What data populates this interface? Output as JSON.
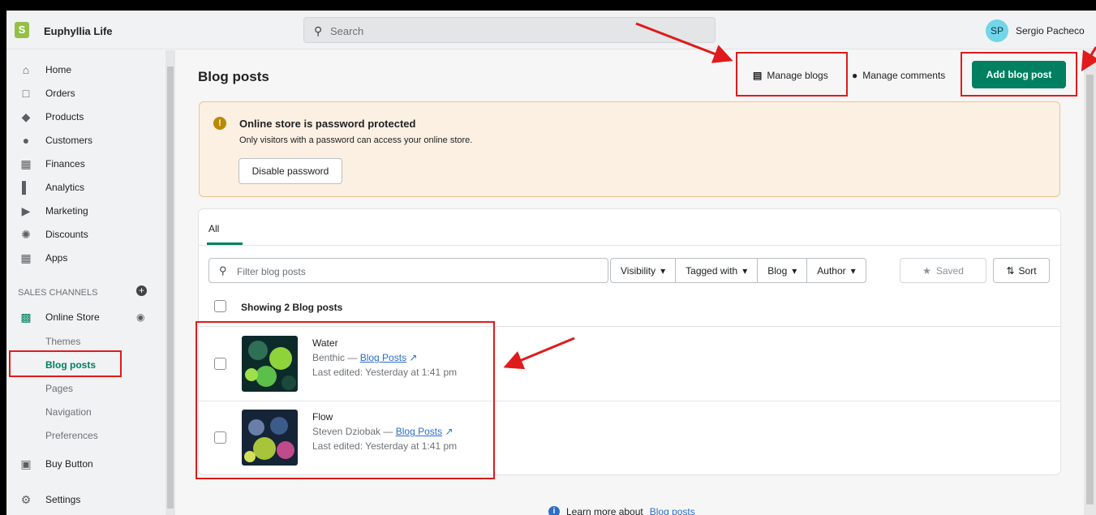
{
  "app": {
    "store_name": "Euphyllia Life",
    "logo_letter": "S"
  },
  "search": {
    "placeholder": "Search"
  },
  "user": {
    "initials": "SP",
    "name": "Sergio Pacheco"
  },
  "sidebar": {
    "items": [
      {
        "label": "Home",
        "icon": "home-icon"
      },
      {
        "label": "Orders",
        "icon": "orders-icon"
      },
      {
        "label": "Products",
        "icon": "tag-icon"
      },
      {
        "label": "Customers",
        "icon": "person-icon"
      },
      {
        "label": "Finances",
        "icon": "finances-icon"
      },
      {
        "label": "Analytics",
        "icon": "bar-chart-icon"
      },
      {
        "label": "Marketing",
        "icon": "megaphone-icon"
      },
      {
        "label": "Discounts",
        "icon": "discount-icon"
      },
      {
        "label": "Apps",
        "icon": "apps-icon"
      }
    ],
    "section_label": "SALES CHANNELS",
    "online_store": "Online Store",
    "subitems": [
      "Themes",
      "Blog posts",
      "Pages",
      "Navigation",
      "Preferences"
    ],
    "active_subitem": "Blog posts",
    "buy_button": "Buy Button",
    "settings": "Settings"
  },
  "header": {
    "title": "Blog posts",
    "manage_blogs": "Manage blogs",
    "manage_comments": "Manage comments",
    "add_blog_post": "Add blog post"
  },
  "banner": {
    "title": "Online store is password protected",
    "body": "Only visitors with a password can access your online store.",
    "button": "Disable password"
  },
  "list": {
    "tab": "All",
    "filter_placeholder": "Filter blog posts",
    "filters": [
      "Visibility",
      "Tagged with",
      "Blog",
      "Author"
    ],
    "saved": "Saved",
    "sort": "Sort",
    "showing": "Showing 2 Blog posts",
    "posts": [
      {
        "title": "Water",
        "author": "Benthic",
        "blog": "Blog Posts",
        "edited": "Last edited: Yesterday at 1:41 pm"
      },
      {
        "title": "Flow",
        "author": "Steven Dziobak",
        "blog": "Blog Posts",
        "edited": "Last edited: Yesterday at 1:41 pm"
      }
    ]
  },
  "footer": {
    "learn_prefix": "Learn more about",
    "learn_link": "Blog posts"
  },
  "colors": {
    "accent": "#008060",
    "annotation": "#e01b1b",
    "warning": "#b98900"
  }
}
